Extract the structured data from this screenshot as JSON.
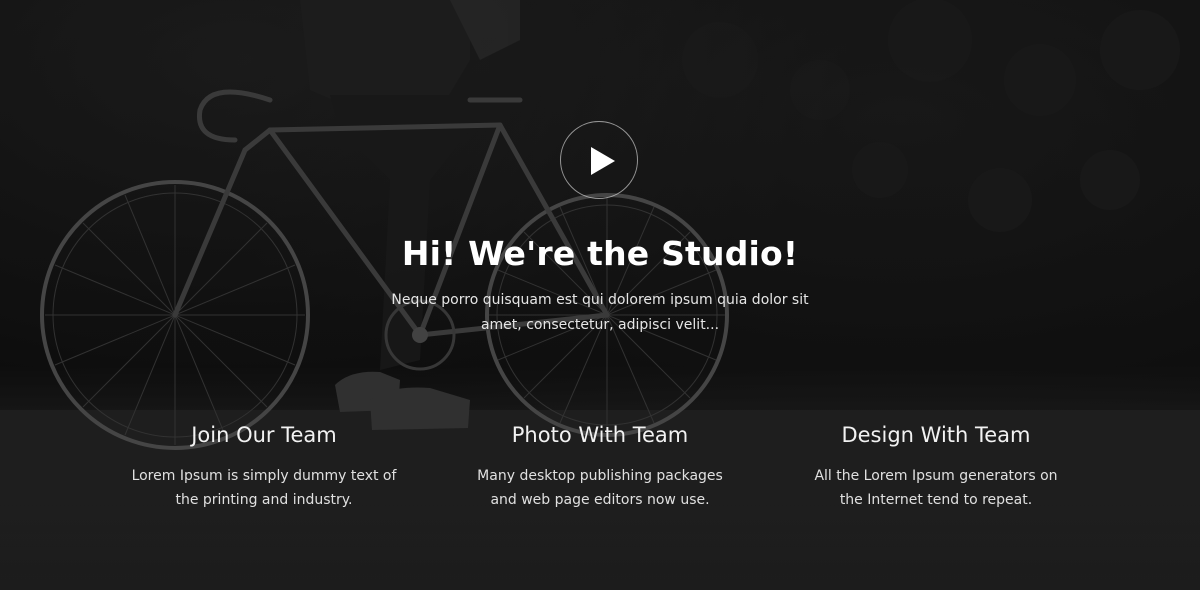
{
  "hero": {
    "title": "Hi! We're the Studio!",
    "subtitle": "Neque porro quisquam est qui dolorem ipsum quia dolor sit amet, consectetur, adipisci velit...",
    "play_icon": "play-icon",
    "background_image": "bicycle-photo"
  },
  "features": [
    {
      "title": "Join Our Team",
      "text": "Lorem Ipsum is simply dummy text of the printing and industry."
    },
    {
      "title": "Photo With Team",
      "text": "Many desktop publishing packages and web page editors now use."
    },
    {
      "title": "Design With Team",
      "text": "All the Lorem Ipsum generators on the Internet tend to repeat."
    }
  ],
  "colors": {
    "overlay": "#151515",
    "text": "#ffffff",
    "muted_text": "#e0e0e0"
  }
}
